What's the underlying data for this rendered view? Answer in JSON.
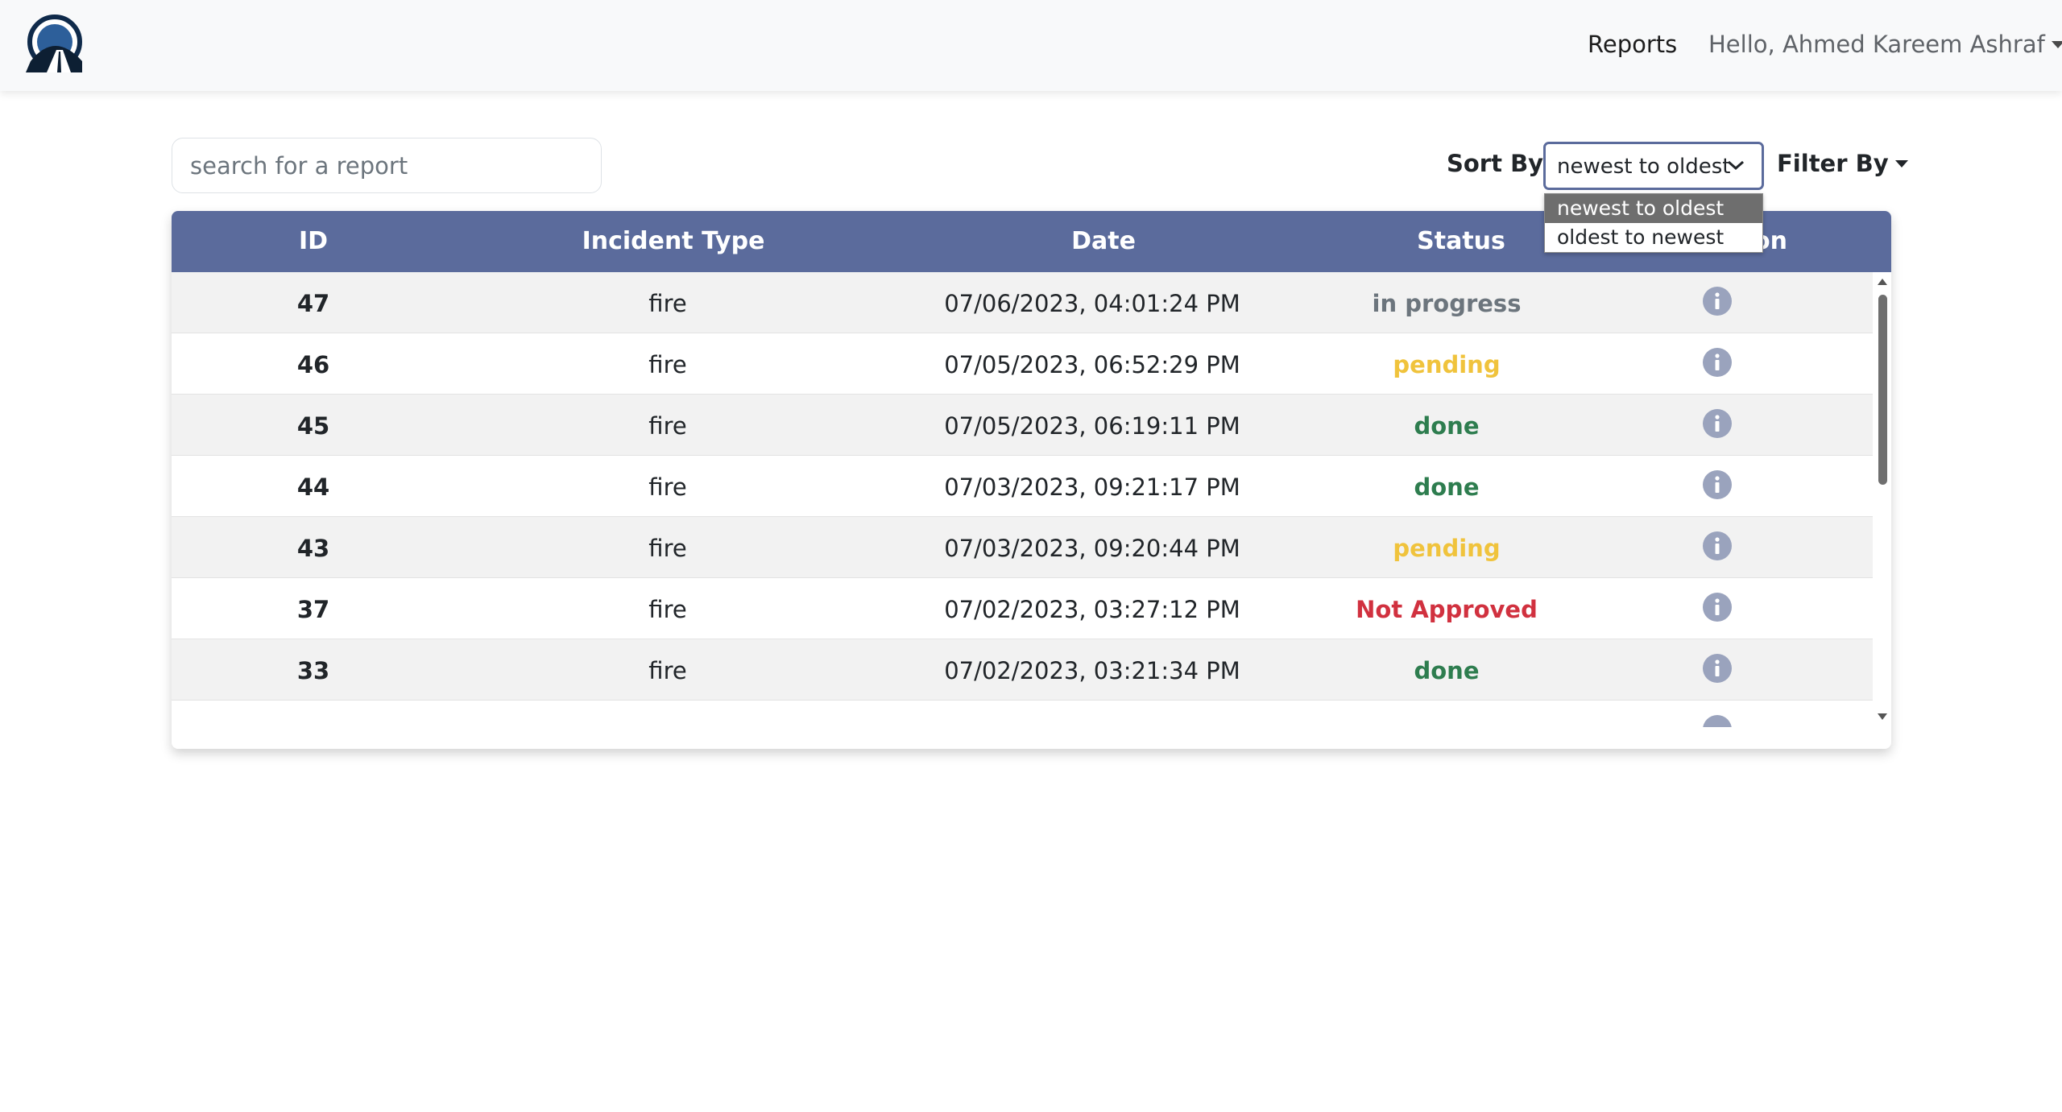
{
  "nav": {
    "logo_icon": "road-tunnel-logo-icon",
    "reports_label": "Reports",
    "user_greeting": "Hello, Ahmed Kareem Ashraf"
  },
  "search": {
    "placeholder": "search for a report",
    "value": ""
  },
  "sort": {
    "label": "Sort By:",
    "selected": "newest to oldest",
    "options": [
      "newest to oldest",
      "oldest to newest"
    ]
  },
  "filter": {
    "label": "Filter By"
  },
  "table": {
    "headers": [
      "ID",
      "Incident Type",
      "Date",
      "Status",
      "on"
    ],
    "rows": [
      {
        "id": "47",
        "type": "fire",
        "date": "07/06/2023, 04:01:24 PM",
        "status": "in progress",
        "status_color": "#6c757d"
      },
      {
        "id": "46",
        "type": "fire",
        "date": "07/05/2023, 06:52:29 PM",
        "status": "pending",
        "status_color": "#f0c33c"
      },
      {
        "id": "45",
        "type": "fire",
        "date": "07/05/2023, 06:19:11 PM",
        "status": "done",
        "status_color": "#2e7d4f"
      },
      {
        "id": "44",
        "type": "fire",
        "date": "07/03/2023, 09:21:17 PM",
        "status": "done",
        "status_color": "#2e7d4f"
      },
      {
        "id": "43",
        "type": "fire",
        "date": "07/03/2023, 09:20:44 PM",
        "status": "pending",
        "status_color": "#f0c33c"
      },
      {
        "id": "37",
        "type": "fire",
        "date": "07/02/2023, 03:27:12 PM",
        "status": "Not Approved",
        "status_color": "#d1313f"
      },
      {
        "id": "33",
        "type": "fire",
        "date": "07/02/2023, 03:21:34 PM",
        "status": "done",
        "status_color": "#2e7d4f"
      }
    ]
  },
  "colors": {
    "header_bg": "#5b6b9c",
    "navbar_bg": "#f8f9fa",
    "info_icon": "#9aa3bd"
  }
}
